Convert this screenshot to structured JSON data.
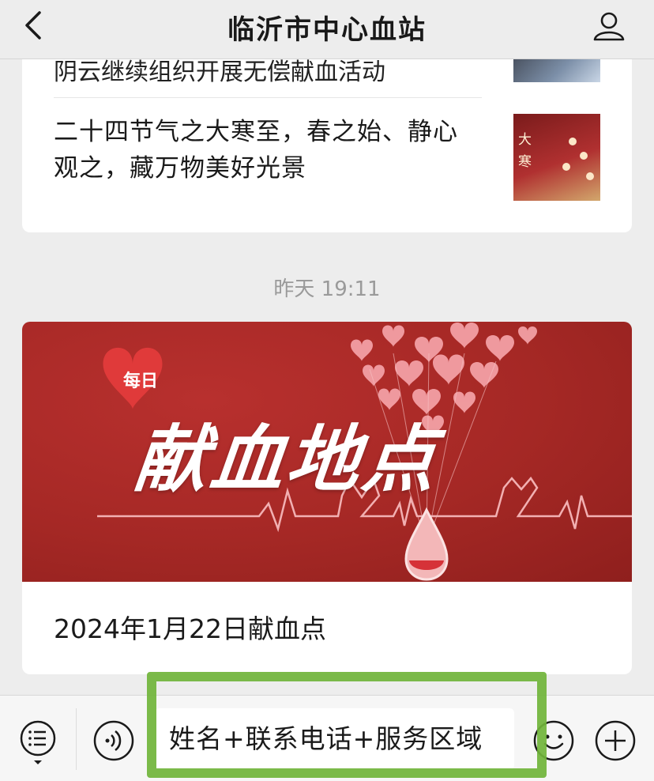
{
  "header": {
    "title": "临沂市中心血站",
    "back_icon": "chevron-left-icon",
    "profile_icon": "person-icon"
  },
  "articles": [
    {
      "title_partial": "阴云继续组织开展无偿献血活动",
      "thumbnail": "photo"
    },
    {
      "title": "二十四节气之大寒至，春之始、静心观之，藏万物美好光景",
      "thumbnail_text": [
        "大",
        "寒"
      ]
    }
  ],
  "timestamp": "昨天 19:11",
  "main_article": {
    "banner_tag": "每日",
    "banner_title": "献血地点",
    "caption": "2024年1月22日献血点"
  },
  "input_bar": {
    "menu_icon": "list-menu-icon",
    "voice_icon": "voice-icon",
    "input_value": "姓名+联系电话+服务区域",
    "emoji_icon": "emoji-icon",
    "plus_icon": "plus-circle-icon"
  },
  "colors": {
    "background": "#ededed",
    "banner_red": "#a52825",
    "highlight_green": "#70b43a"
  }
}
